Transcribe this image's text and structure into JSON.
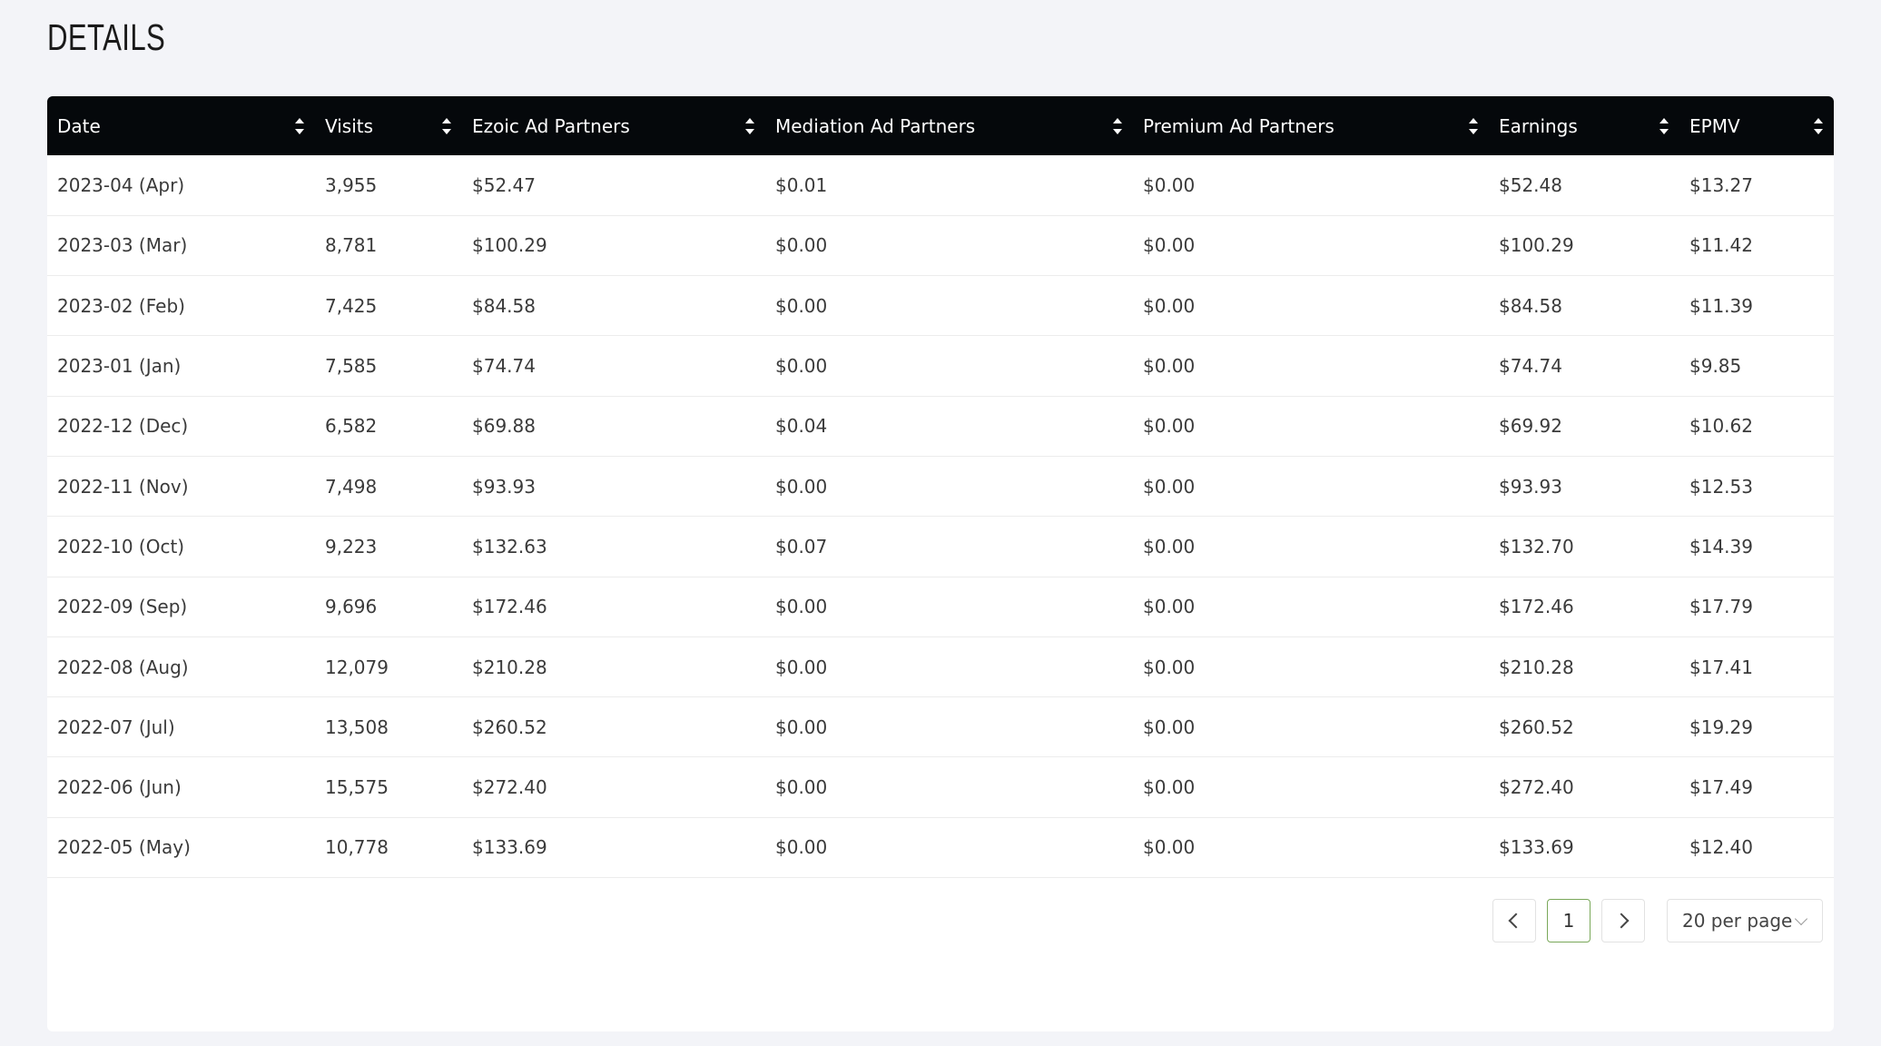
{
  "page": {
    "title": "DETAILS"
  },
  "table": {
    "columns": [
      "Date",
      "Visits",
      "Ezoic Ad Partners",
      "Mediation Ad Partners",
      "Premium Ad Partners",
      "Earnings",
      "EPMV"
    ],
    "rows": [
      [
        "2023-04 (Apr)",
        "3,955",
        "$52.47",
        "$0.01",
        "$0.00",
        "$52.48",
        "$13.27"
      ],
      [
        "2023-03 (Mar)",
        "8,781",
        "$100.29",
        "$0.00",
        "$0.00",
        "$100.29",
        "$11.42"
      ],
      [
        "2023-02 (Feb)",
        "7,425",
        "$84.58",
        "$0.00",
        "$0.00",
        "$84.58",
        "$11.39"
      ],
      [
        "2023-01 (Jan)",
        "7,585",
        "$74.74",
        "$0.00",
        "$0.00",
        "$74.74",
        "$9.85"
      ],
      [
        "2022-12 (Dec)",
        "6,582",
        "$69.88",
        "$0.04",
        "$0.00",
        "$69.92",
        "$10.62"
      ],
      [
        "2022-11 (Nov)",
        "7,498",
        "$93.93",
        "$0.00",
        "$0.00",
        "$93.93",
        "$12.53"
      ],
      [
        "2022-10 (Oct)",
        "9,223",
        "$132.63",
        "$0.07",
        "$0.00",
        "$132.70",
        "$14.39"
      ],
      [
        "2022-09 (Sep)",
        "9,696",
        "$172.46",
        "$0.00",
        "$0.00",
        "$172.46",
        "$17.79"
      ],
      [
        "2022-08 (Aug)",
        "12,079",
        "$210.28",
        "$0.00",
        "$0.00",
        "$210.28",
        "$17.41"
      ],
      [
        "2022-07 (Jul)",
        "13,508",
        "$260.52",
        "$0.00",
        "$0.00",
        "$260.52",
        "$19.29"
      ],
      [
        "2022-06 (Jun)",
        "15,575",
        "$272.40",
        "$0.00",
        "$0.00",
        "$272.40",
        "$17.49"
      ],
      [
        "2022-05 (May)",
        "10,778",
        "$133.69",
        "$0.00",
        "$0.00",
        "$133.69",
        "$12.40"
      ]
    ]
  },
  "pagination": {
    "current_page": "1",
    "per_page_label": "20 per page"
  },
  "icons": {
    "prev": "chevron-left-icon",
    "next": "chevron-right-icon",
    "sort": "sort-icon",
    "dropdown": "chevron-down-icon"
  },
  "colors": {
    "header_bg": "#05080b",
    "active_page_border": "#7aa85a",
    "page_bg": "#f3f4f8"
  }
}
